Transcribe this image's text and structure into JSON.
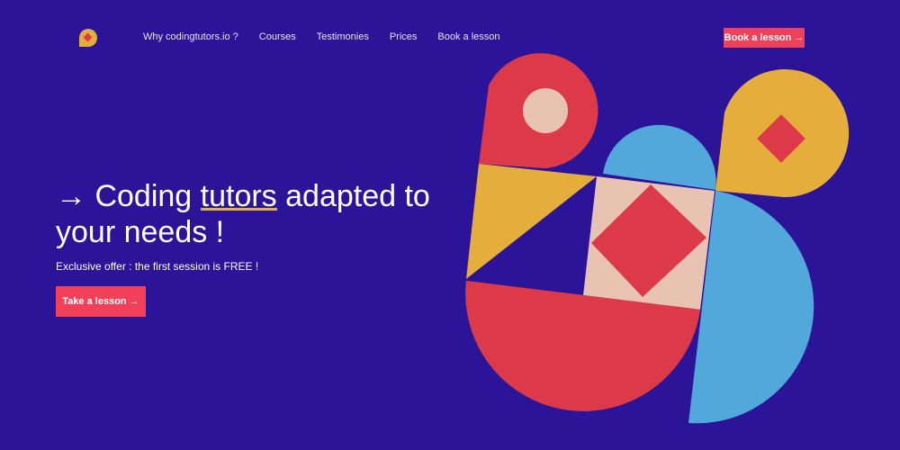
{
  "logo": {
    "icon": "speech-bubble-logo-icon"
  },
  "nav": {
    "items": [
      {
        "label": "Why codingtutors.io ?"
      },
      {
        "label": "Courses"
      },
      {
        "label": "Testimonies"
      },
      {
        "label": "Prices"
      },
      {
        "label": "Book a lesson"
      }
    ],
    "cta_label": "Book a lesson →"
  },
  "hero": {
    "title_prefix": "→ Coding ",
    "title_highlight": "tutors",
    "title_suffix": " adapted to your needs !",
    "subtitle": "Exclusive offer : the first session is FREE !",
    "cta_label": "Take a lesson →"
  },
  "colors": {
    "background": "#2c1499",
    "accent": "#f0405a",
    "red": "#dc3a48",
    "blue": "#52a8da",
    "yellow": "#e4ad3c",
    "peach": "#e9c3b2",
    "underline": "#e8b23a"
  }
}
